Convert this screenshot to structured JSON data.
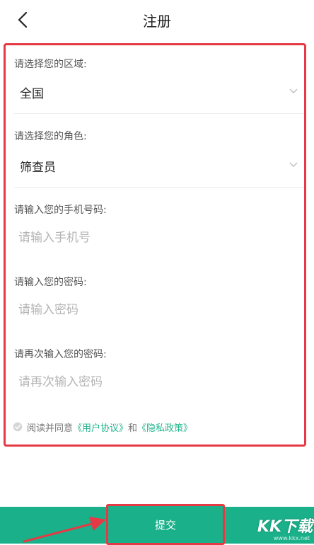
{
  "header": {
    "title": "注册"
  },
  "form": {
    "region": {
      "label": "请选择您的区域:",
      "value": "全国"
    },
    "role": {
      "label": "请选择您的角色:",
      "value": "筛查员"
    },
    "phone": {
      "label": "请输入您的手机号码:",
      "placeholder": "请输入手机号"
    },
    "password": {
      "label": "请输入您的密码:",
      "placeholder": "请输入密码"
    },
    "confirm": {
      "label": "请再次输入您的密码:",
      "placeholder": "请再次输入密码"
    },
    "agreement": {
      "prefix": "阅读并同意",
      "user_agreement": "《用户协议》",
      "and": "和",
      "privacy_policy": "《隐私政策》"
    }
  },
  "footer": {
    "submit_label": "提交"
  },
  "watermark": {
    "main": "KK下载",
    "sub": "www.kkx.net"
  },
  "colors": {
    "accent": "#1ab089",
    "highlight_border": "#e53a45",
    "link": "#21b48c"
  },
  "icons": {
    "back": "chevron-left-icon",
    "dropdown": "chevron-down-icon",
    "check": "check-circle-icon"
  }
}
